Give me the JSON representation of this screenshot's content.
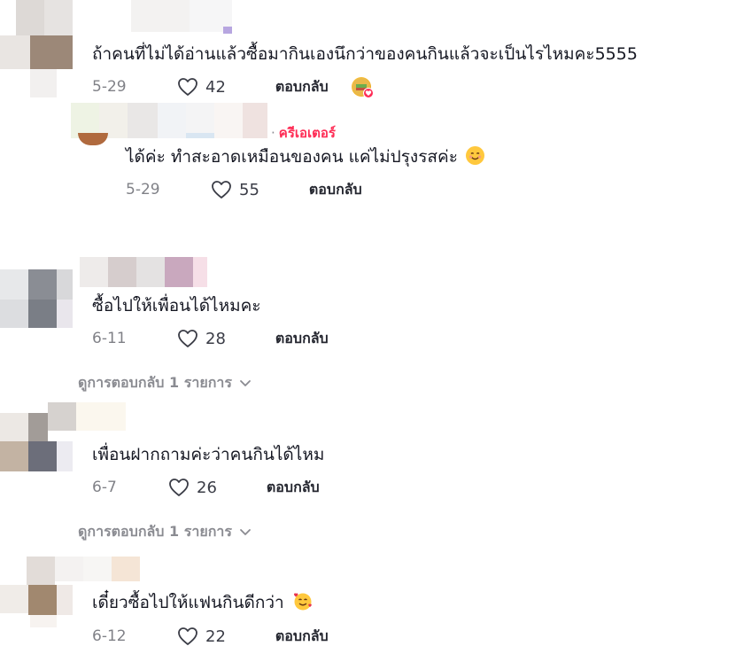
{
  "comments": [
    {
      "text": "ถ้าคนที่ไม่ได้อ่านแล้วซื้อมากินเองนึกว่าของคนกินแล้วจะเป็นไรไหมคะ5555",
      "date": "5-29",
      "likes": "42",
      "reply_label": "ตอบกลับ",
      "liked_by_creator_icon": "creator-liked-badge-icon"
    },
    {
      "creator_label": "ครีเอเตอร์",
      "text": "ได้ค่ะ ทำสะอาดเหมือนของคน แค่ไม่ปรุงรสค่ะ",
      "text_emoji": "smiling-face-emoji",
      "date": "5-29",
      "likes": "55",
      "reply_label": "ตอบกลับ"
    },
    {
      "text": "ซื้อไปให้เพื่อนได้ไหมคะ",
      "date": "6-11",
      "likes": "28",
      "reply_label": "ตอบกลับ",
      "view_replies": "ดูการตอบกลับ 1 รายการ"
    },
    {
      "text": "เพื่อนฝากถามค่ะว่าคนกินได้ไหม",
      "date": "6-7",
      "likes": "26",
      "reply_label": "ตอบกลับ",
      "view_replies": "ดูการตอบกลับ 1 รายการ"
    },
    {
      "text": "เดี๋ยวซื้อไปให้แฟนกินดีกว่า",
      "text_emoji": "smiling-face-with-hearts-emoji",
      "date": "6-12",
      "likes": "22",
      "reply_label": "ตอบกลับ"
    }
  ],
  "colors": {
    "text": "#161823",
    "muted": "#8a8b91",
    "creator_accent": "#fe2c55"
  }
}
